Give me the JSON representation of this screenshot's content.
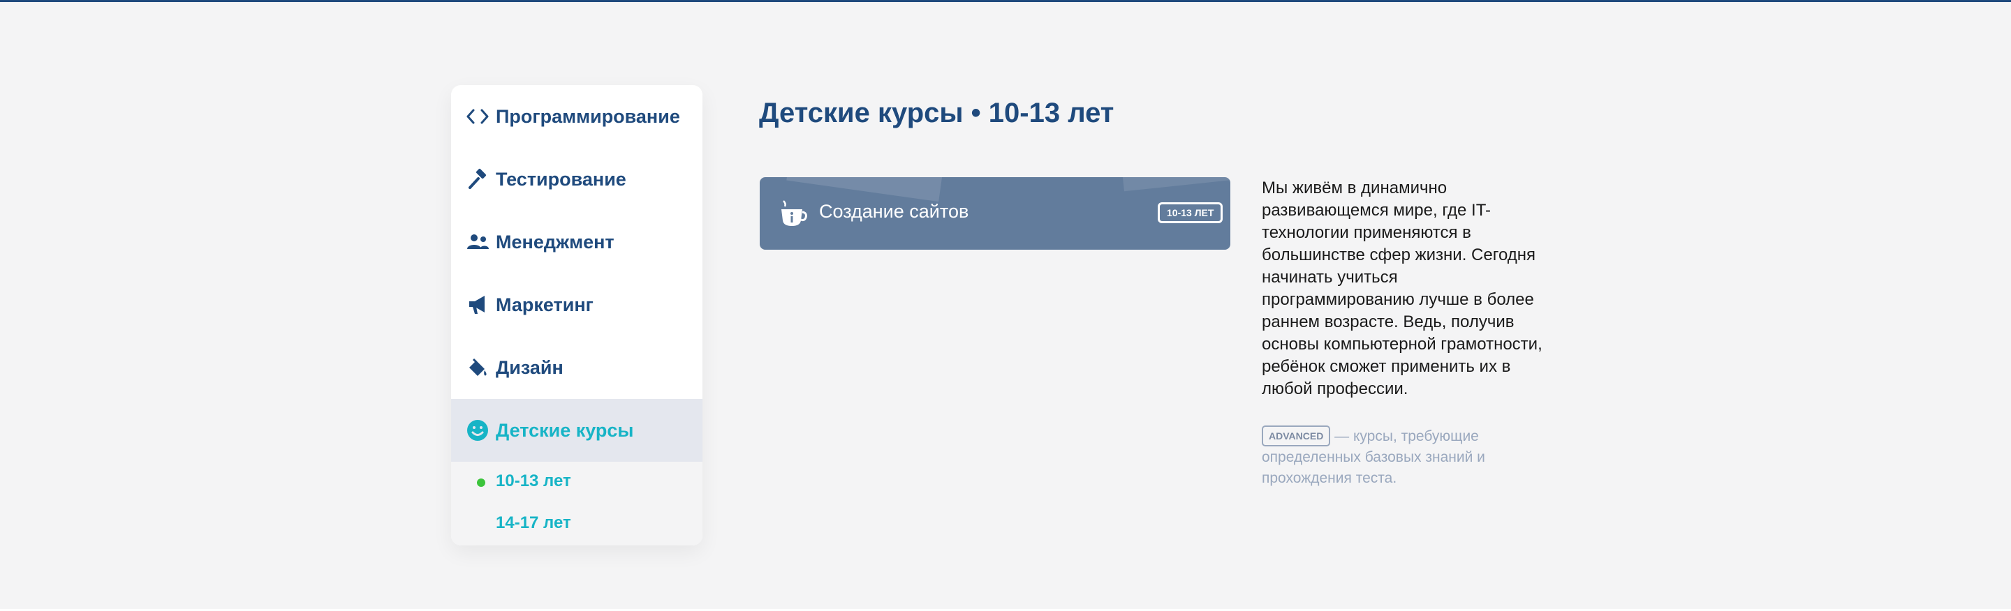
{
  "sidebar": {
    "items": [
      {
        "label": "Программирование",
        "icon": "code-icon"
      },
      {
        "label": "Тестирование",
        "icon": "hammer-icon"
      },
      {
        "label": "Менеджмент",
        "icon": "people-icon"
      },
      {
        "label": "Маркетинг",
        "icon": "megaphone-icon"
      },
      {
        "label": "Дизайн",
        "icon": "paint-bucket-icon"
      },
      {
        "label": "Детские курсы",
        "icon": "smiley-icon",
        "active": true
      }
    ],
    "subitems": [
      {
        "label": "10-13 лет",
        "active": true
      },
      {
        "label": "14-17 лет"
      }
    ]
  },
  "main": {
    "title": "Детские курсы • 10-13 лет",
    "course": {
      "name": "Создание сайтов",
      "badge": "10-13 ЛЕТ",
      "icon": "teacup-info-icon"
    },
    "description": "Мы живём в динамично развивающемся мире, где IT-технологии применяются в большинстве сфер жизни. Сегодня начинать учиться программированию лучше в более раннем возрасте. Ведь, получив основы компьютерной грамотности, ребёнок сможет применить их в любой профессии.",
    "legend": {
      "tag": "ADVANCED",
      "text": " — курсы, требующие определенных базовых знаний и прохождения теста."
    }
  },
  "colors": {
    "brand": "#1f4a7d",
    "accent": "#17b4c6",
    "card": "#627c9c",
    "dot": "#3cc43c",
    "muted": "#9aa8be"
  }
}
